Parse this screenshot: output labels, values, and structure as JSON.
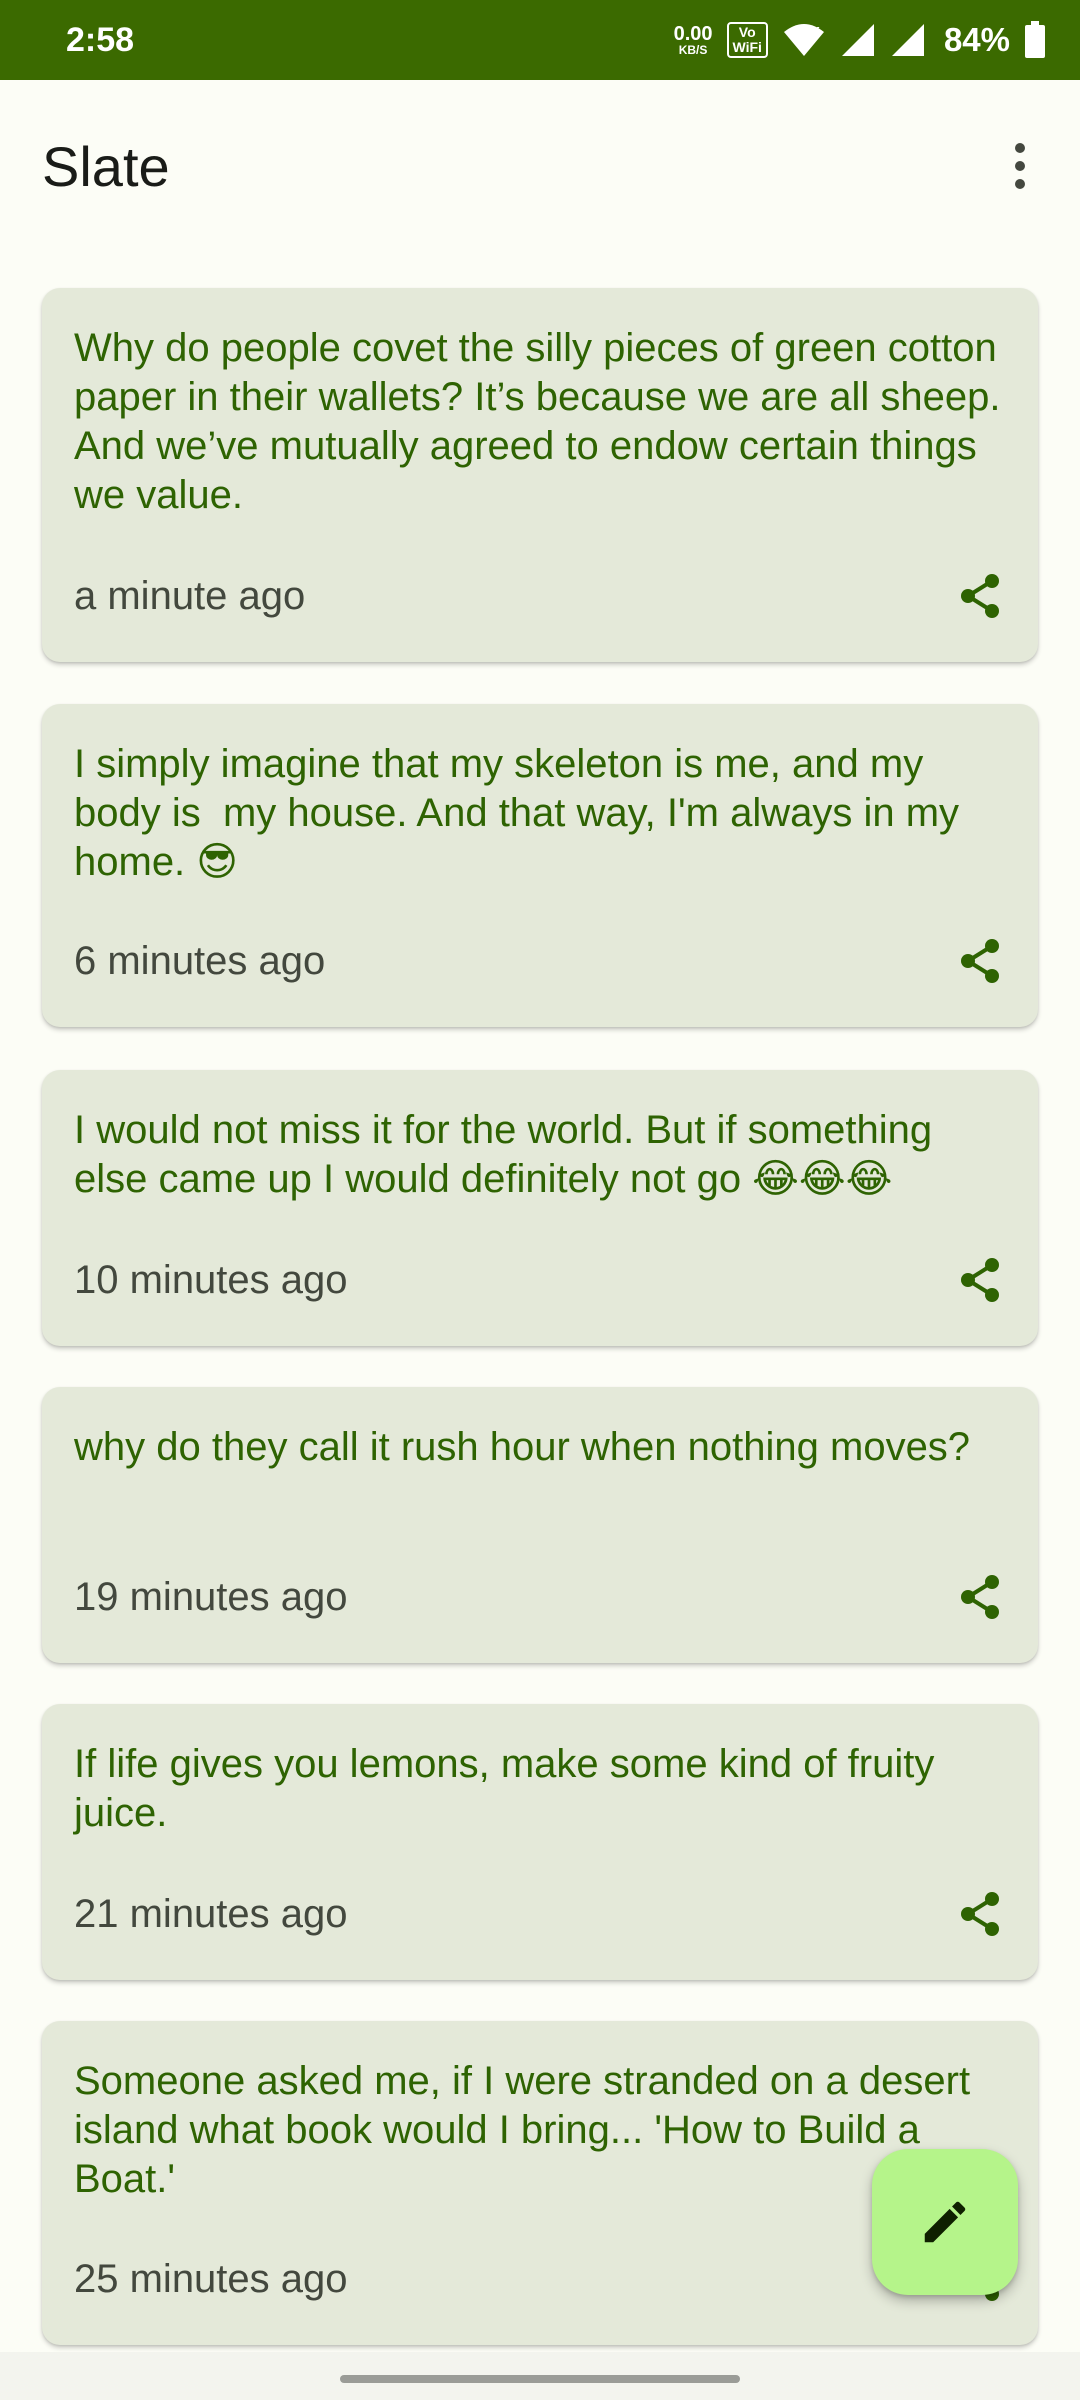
{
  "status_bar": {
    "time": "2:58",
    "net_speed_value": "0.00",
    "net_speed_unit": "KB/S",
    "vowifi_line1": "Vo",
    "vowifi_line2": "WiFi",
    "battery_percent": "84%",
    "icons": [
      "wifi-icon",
      "cellular-signal-icon",
      "cellular-signal-icon",
      "battery-icon"
    ]
  },
  "app_bar": {
    "title": "Slate",
    "menu_icon": "more-vert-icon"
  },
  "notes": [
    {
      "text": "Why do people covet the silly pieces of green cotton paper in their wallets? It’s because we are all sheep. And we’ve mutually agreed to endow certain things we value.",
      "time": "a minute ago"
    },
    {
      "text": "I simply imagine that my skeleton is me, and my body is  my house. And that way, I'm always in my home. 😎",
      "time": "6 minutes ago"
    },
    {
      "text": "I would not miss it for the world. But if something else came up I would definitely not go 😂😂😂",
      "time": "10 minutes ago"
    },
    {
      "text": "why do they call it rush hour when nothing moves?",
      "time": "19 minutes ago"
    },
    {
      "text": "If life gives you lemons, make some kind of fruity juice.",
      "time": "21 minutes ago"
    },
    {
      "text": "Someone asked me, if I were stranded on a desert island what book would I bring... 'How to Build a Boat.'",
      "time": "25 minutes ago"
    }
  ],
  "fab_icon": "edit-pencil-icon",
  "colors": {
    "status_bar_bg": "#3B6A00",
    "background": "#FCFDF6",
    "card_bg": "#E4E9D9",
    "note_text": "#2E6302",
    "timestamp_text": "#43483E",
    "share_icon": "#2E6302",
    "fab_bg": "#B5F48A"
  }
}
